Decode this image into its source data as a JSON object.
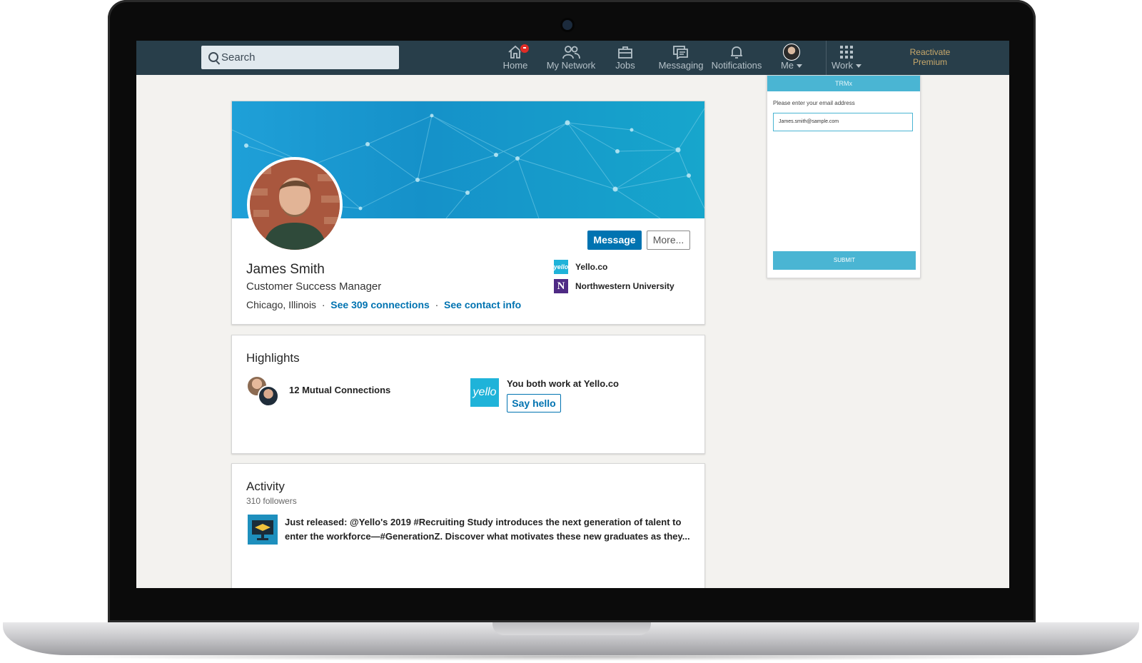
{
  "nav": {
    "search_placeholder": "Search",
    "items": [
      {
        "label": "Home",
        "icon": "home-icon"
      },
      {
        "label": "My Network",
        "icon": "network-icon"
      },
      {
        "label": "Jobs",
        "icon": "briefcase-icon"
      },
      {
        "label": "Messaging",
        "icon": "messaging-icon"
      },
      {
        "label": "Notifications",
        "icon": "bell-icon"
      },
      {
        "label": "Me",
        "icon": "avatar"
      },
      {
        "label": "Work",
        "icon": "grid-icon"
      }
    ],
    "premium_line1": "Reactivate",
    "premium_line2": "Premium"
  },
  "profile": {
    "name": "James Smith",
    "headline": "Customer Success Manager",
    "location": "Chicago, Illinois",
    "connections_link": "See 309 connections",
    "contact_link": "See contact info",
    "message_button": "Message",
    "more_button": "More...",
    "orgs": [
      {
        "name": "Yello.co",
        "logo_text": "yello",
        "color": "#1fb3d9"
      },
      {
        "name": "Northwestern University",
        "logo_text": "N",
        "color": "#4e2a84"
      }
    ]
  },
  "highlights": {
    "title": "Highlights",
    "mutual": "12 Mutual Connections",
    "work_text": "You both work at Yello.co",
    "logo_text": "yello",
    "say_hello": "Say hello"
  },
  "activity": {
    "title": "Activity",
    "followers": "310 followers",
    "post_line1": "Just released: @Yello's 2019 #Recruiting Study introduces the next generation of talent to",
    "post_line2": "enter the workforce—#GenerationZ. Discover what motivates these new graduates as they..."
  },
  "trmx": {
    "title": "TRMx",
    "label": "Please enter your email address",
    "email_value": "James.smith@sample.com",
    "submit": "SUBMIT"
  },
  "colors": {
    "nav_bg": "#283e4a",
    "brand_blue": "#0073b1",
    "trmx_accent": "#4ab5d3",
    "premium_gold": "#c8a86b"
  }
}
